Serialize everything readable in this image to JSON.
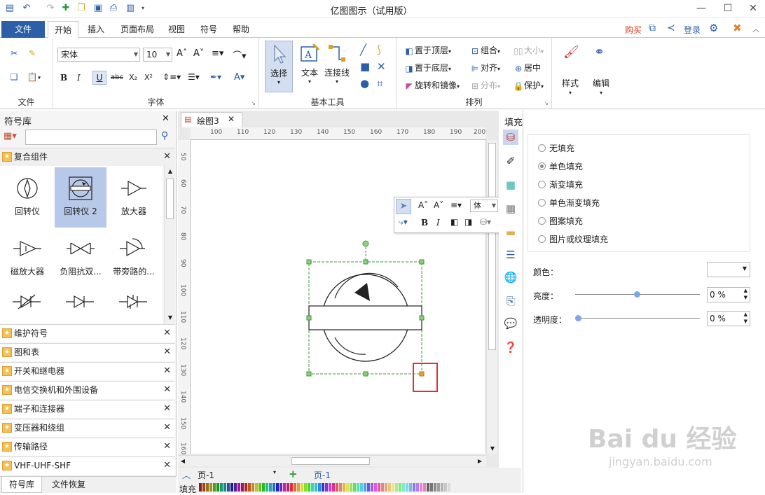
{
  "app": {
    "title": "亿图图示（试用版）"
  },
  "tabs": {
    "file": "文件",
    "items": [
      "开始",
      "插入",
      "页面布局",
      "视图",
      "符号",
      "帮助"
    ],
    "active": "开始"
  },
  "header_right": {
    "buy": "购买",
    "login": "登录"
  },
  "ribbon": {
    "file_group": {
      "label": "文件"
    },
    "font_group": {
      "label": "字体",
      "font_name": "宋体",
      "font_size": "10"
    },
    "basic_tools": {
      "label": "基本工具",
      "select": "选择",
      "text": "文本",
      "connector": "连接线"
    },
    "arrange": {
      "label": "排列",
      "bring_front": "置于顶层",
      "send_back": "置于底层",
      "rotate": "旋转和镜像",
      "group": "组合",
      "align": "对齐",
      "distribute": "分布",
      "size": "大小",
      "center": "居中",
      "protect": "保护"
    },
    "style": {
      "label": "样式"
    },
    "edit": {
      "label": "编辑"
    }
  },
  "symbol_panel": {
    "title": "符号库",
    "search_placeholder": "",
    "open_category": "复合组件",
    "shapes": [
      "回转仪",
      "回转仪 2",
      "放大器",
      "磁放大器",
      "负阻抗双...",
      "带旁路的..."
    ],
    "categories": [
      "维护符号",
      "图和表",
      "开关和继电器",
      "电信交换机和外围设备",
      "端子和连接器",
      "变压器和绕组",
      "传输路径",
      "VHF-UHF-SHF"
    ],
    "bottom_tabs": [
      "符号库",
      "文件恢复"
    ]
  },
  "document": {
    "tab_name": "绘图3",
    "ruler_top": [
      "100",
      "110",
      "120",
      "130",
      "140",
      "150",
      "160",
      "170",
      "180",
      "190",
      "200"
    ],
    "ruler_left": [
      "50",
      "60",
      "70",
      "80",
      "90",
      "100",
      "110",
      "120",
      "130",
      "140",
      "150",
      "160"
    ],
    "page_tab": "页-1",
    "page_tab_active": "页-1",
    "fill_label": "填充"
  },
  "float_toolbar": {
    "font": "体"
  },
  "fill_panel": {
    "title": "填充",
    "options": [
      "无填充",
      "单色填充",
      "渐变填充",
      "单色渐变填充",
      "图案填充",
      "图片或纹理填充"
    ],
    "selected": "单色填充",
    "color_label": "颜色：",
    "brightness_label": "亮度：",
    "brightness_value": "0 %",
    "transparency_label": "透明度：",
    "transparency_value": "0 %"
  },
  "colors": {
    "accent": "#2b5fa8",
    "highlight": "#e03030",
    "selected_shape": "#b8c8e8"
  },
  "watermark": {
    "brand": "Bai du 经验",
    "url": "jingyan.baidu.com"
  }
}
